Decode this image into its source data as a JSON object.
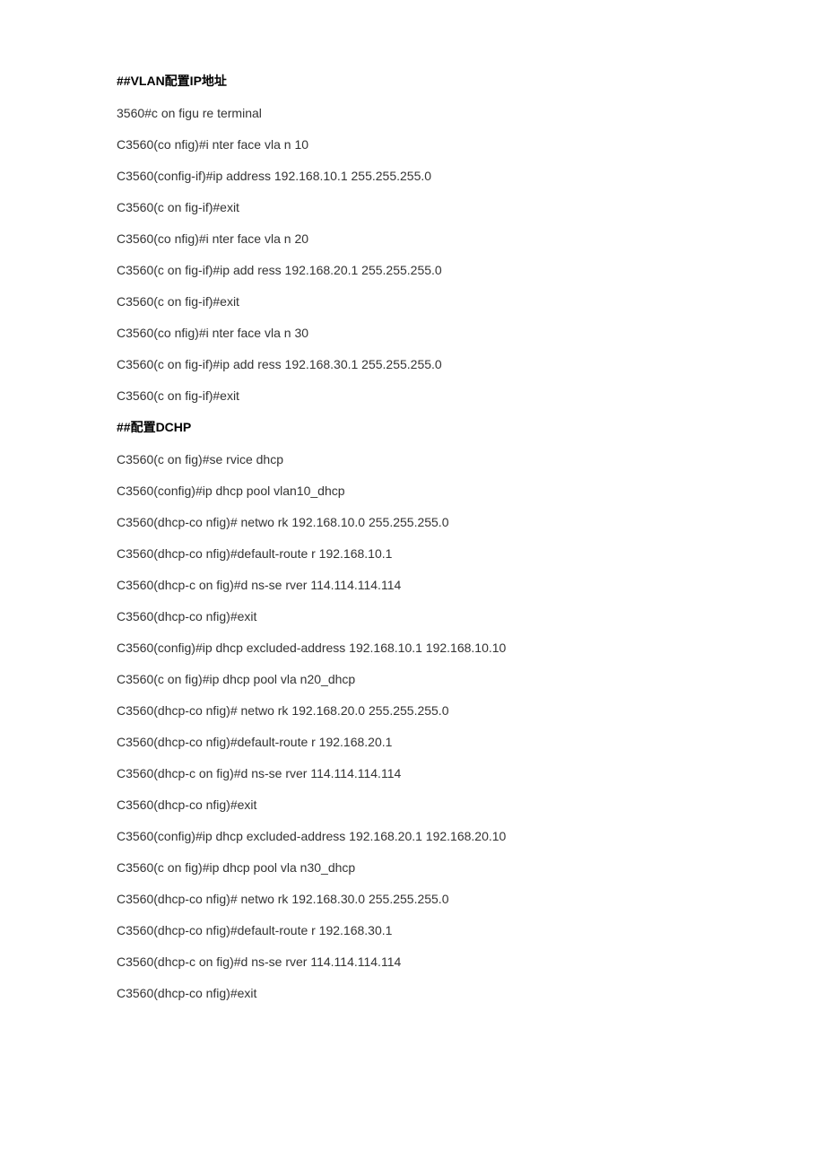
{
  "sections": [
    {
      "heading": "##VLAN配置IP地址",
      "lines": [
        "3560#c on figu re terminal",
        "C3560(co nfig)#i nter face vla n 10",
        "C3560(config-if)#ip address 192.168.10.1 255.255.255.0",
        "C3560(c on fig-if)#exit",
        "C3560(co nfig)#i nter face vla n 20",
        "C3560(c on fig-if)#ip add ress 192.168.20.1 255.255.255.0",
        "C3560(c on fig-if)#exit",
        "C3560(co nfig)#i nter face vla n 30",
        "C3560(c on fig-if)#ip add ress 192.168.30.1 255.255.255.0",
        "C3560(c on fig-if)#exit"
      ]
    },
    {
      "heading": "##配置DCHP",
      "lines": [
        "C3560(c on fig)#se rvice dhcp",
        "C3560(config)#ip dhcp pool vlan10_dhcp",
        "C3560(dhcp-co nfig)# netwo rk 192.168.10.0 255.255.255.0",
        "C3560(dhcp-co nfig)#default-route r 192.168.10.1",
        "C3560(dhcp-c on fig)#d ns-se rver 114.114.114.114",
        "C3560(dhcp-co nfig)#exit",
        "C3560(config)#ip dhcp excluded-address 192.168.10.1 192.168.10.10",
        "C3560(c on fig)#ip dhcp pool vla n20_dhcp",
        "C3560(dhcp-co nfig)# netwo rk 192.168.20.0 255.255.255.0",
        "C3560(dhcp-co nfig)#default-route r 192.168.20.1",
        "C3560(dhcp-c on fig)#d ns-se rver 114.114.114.114",
        "C3560(dhcp-co nfig)#exit",
        "C3560(config)#ip dhcp excluded-address 192.168.20.1 192.168.20.10",
        "C3560(c on fig)#ip dhcp pool vla n30_dhcp",
        "C3560(dhcp-co nfig)# netwo rk 192.168.30.0 255.255.255.0",
        "C3560(dhcp-co nfig)#default-route r 192.168.30.1",
        "C3560(dhcp-c on fig)#d ns-se rver 114.114.114.114",
        "C3560(dhcp-co nfig)#exit"
      ]
    }
  ]
}
